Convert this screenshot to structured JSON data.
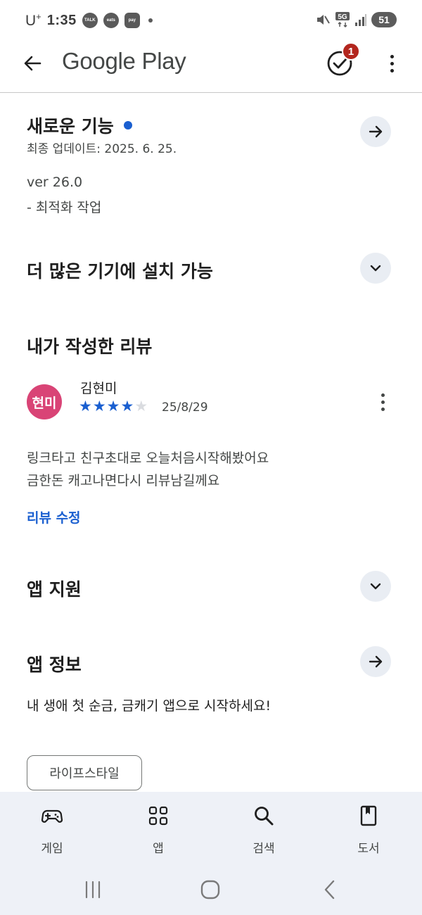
{
  "status_bar": {
    "carrier": "U",
    "carrier_sup": "+",
    "time": "1:35",
    "notif_1": "TALK",
    "notif_2": "eats",
    "notif_3": "pay",
    "network": "5G",
    "battery": "51"
  },
  "app_bar": {
    "title": "Google Play",
    "badge_count": "1"
  },
  "whats_new": {
    "title": "새로운 기능",
    "updated": "최종 업데이트: 2025. 6. 25.",
    "version": "ver 26.0",
    "note": "- 최적화 작업"
  },
  "more_devices": {
    "title": "더 많은 기기에 설치 가능"
  },
  "my_review": {
    "title": "내가 작성한 리뷰",
    "avatar_text": "현미",
    "reviewer_name": "김현미",
    "rating": 4,
    "rating_max": 5,
    "date": "25/8/29",
    "line_1": "링크타고 친구초대로 오늘처음시작해봤어요",
    "line_2": "금한돈 캐고나면다시 리뷰남길께요",
    "edit_label": "리뷰 수정"
  },
  "app_support": {
    "title": "앱 지원"
  },
  "app_info": {
    "title": "앱 정보",
    "description": "내 생애 첫 순금, 금캐기 앱으로 시작하세요!",
    "category_chip": "라이프스타일"
  },
  "bottom_nav": {
    "items": [
      {
        "label": "게임",
        "icon": "gamepad-icon"
      },
      {
        "label": "앱",
        "icon": "apps-grid-icon"
      },
      {
        "label": "검색",
        "icon": "search-icon"
      },
      {
        "label": "도서",
        "icon": "book-icon"
      }
    ]
  },
  "colors": {
    "accent": "#1a5fd0",
    "badge": "#b3261e",
    "avatar": "#d94476",
    "button_bg": "#e9edf3",
    "nav_bg": "#eef1f7"
  }
}
